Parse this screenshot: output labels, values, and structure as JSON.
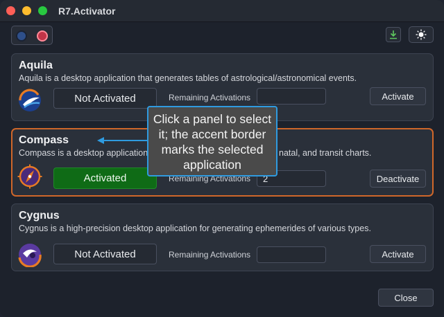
{
  "window": {
    "title": "R7.Activator"
  },
  "toolbar": {
    "download_icon": "download-icon",
    "theme_icon": "sun-icon"
  },
  "apps": [
    {
      "name": "Aquila",
      "description": "Aquila is a desktop application that generates tables of astrological/astronomical events.",
      "status": "Not Activated",
      "remaining_label": "Remaining Activations",
      "remaining_value": "",
      "action_label": "Activate",
      "selected": false,
      "icon": "aquila-logo-icon"
    },
    {
      "name": "Compass",
      "description": "Compass is a desktop application",
      "description_tail": "natal, and transit charts.",
      "status": "Activated",
      "remaining_label": "Remaining Activations",
      "remaining_value": "2",
      "action_label": "Deactivate",
      "selected": true,
      "icon": "compass-logo-icon"
    },
    {
      "name": "Cygnus",
      "description": "Cygnus is a high-precision desktop application for generating ephemerides of various types.",
      "status": "Not Activated",
      "remaining_label": "Remaining Activations",
      "remaining_value": "",
      "action_label": "Activate",
      "selected": false,
      "icon": "cygnus-logo-icon"
    }
  ],
  "footer": {
    "close_label": "Close"
  },
  "callout": {
    "text": "Click a panel to select it; the accent border marks the selected application"
  },
  "colors": {
    "accent": "#d0672a",
    "activated": "#0f6b16",
    "callout_border": "#2f9be0"
  }
}
